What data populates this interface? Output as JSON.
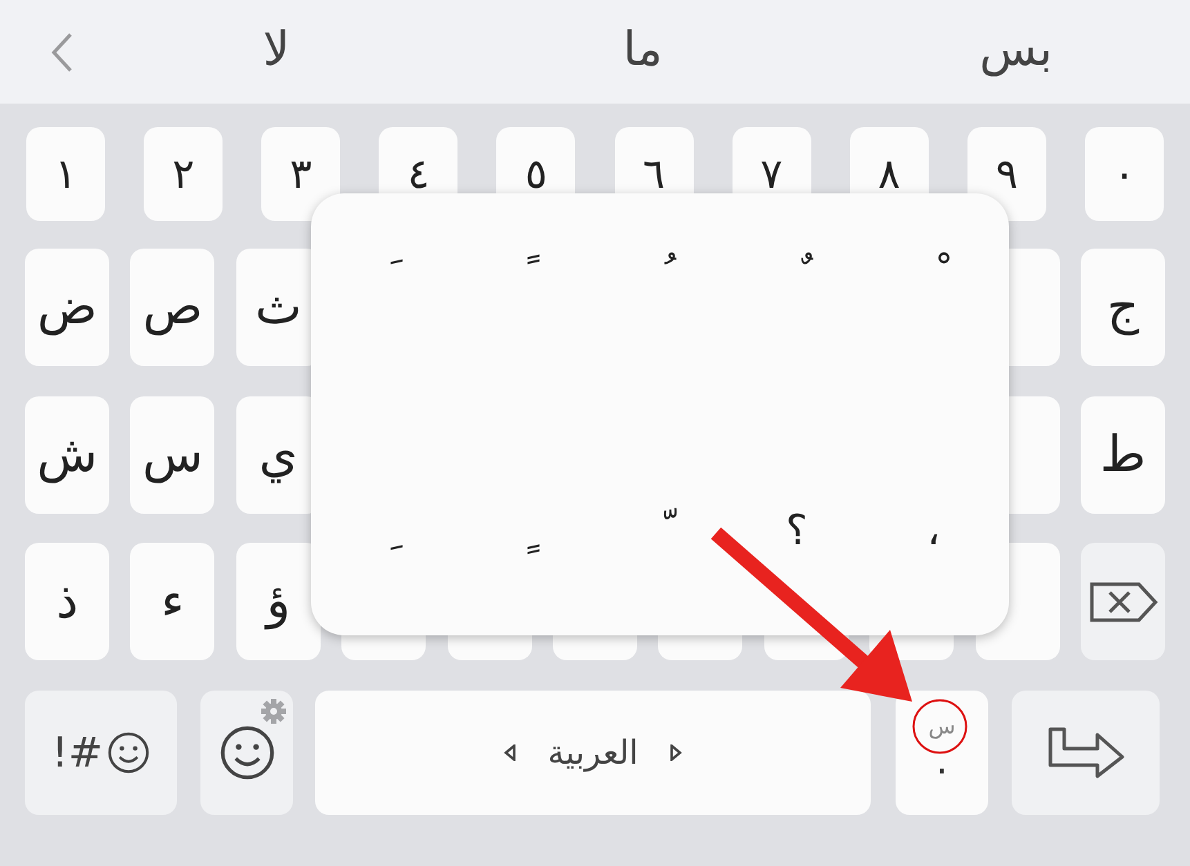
{
  "suggestion_bar": {
    "words": [
      "بس",
      "ما",
      "لا"
    ]
  },
  "number_row": [
    "٠",
    "٩",
    "٨",
    "٧",
    "٦",
    "٥",
    "٤",
    "٣",
    "٢",
    "١"
  ],
  "letter_rows": [
    {
      "right": [
        {
          "kind": "letter",
          "label": "ج"
        },
        {
          "kind": "blank"
        }
      ],
      "left": [
        {
          "kind": "letter",
          "label": "ث"
        },
        {
          "kind": "letter",
          "label": "ص"
        },
        {
          "kind": "letter",
          "label": "ض"
        }
      ]
    },
    {
      "right": [
        {
          "kind": "letter",
          "label": "ط"
        },
        {
          "kind": "blank"
        }
      ],
      "left": [
        {
          "kind": "letter",
          "label": "ي"
        },
        {
          "kind": "letter",
          "label": "س"
        },
        {
          "kind": "letter",
          "label": "ش"
        }
      ]
    },
    {
      "right": [
        {
          "kind": "backspace"
        },
        {
          "kind": "blank"
        }
      ],
      "left": [
        {
          "kind": "letter",
          "label": "ؤ"
        },
        {
          "kind": "letter",
          "label": "ء"
        },
        {
          "kind": "letter",
          "label": "ذ"
        }
      ]
    }
  ],
  "bottom_row": {
    "symbols_key": {
      "label": "!#"
    },
    "space_bar": {
      "label": "العربية"
    },
    "period_key": {
      "hint": "س",
      "label": "."
    }
  },
  "accent_popup": {
    "rows": [
      [
        "ْ",
        "ٌ",
        "ُ",
        "ً",
        "َ"
      ],
      [
        "،",
        "؟",
        "ّ",
        "ٍ",
        "ِ"
      ]
    ]
  }
}
